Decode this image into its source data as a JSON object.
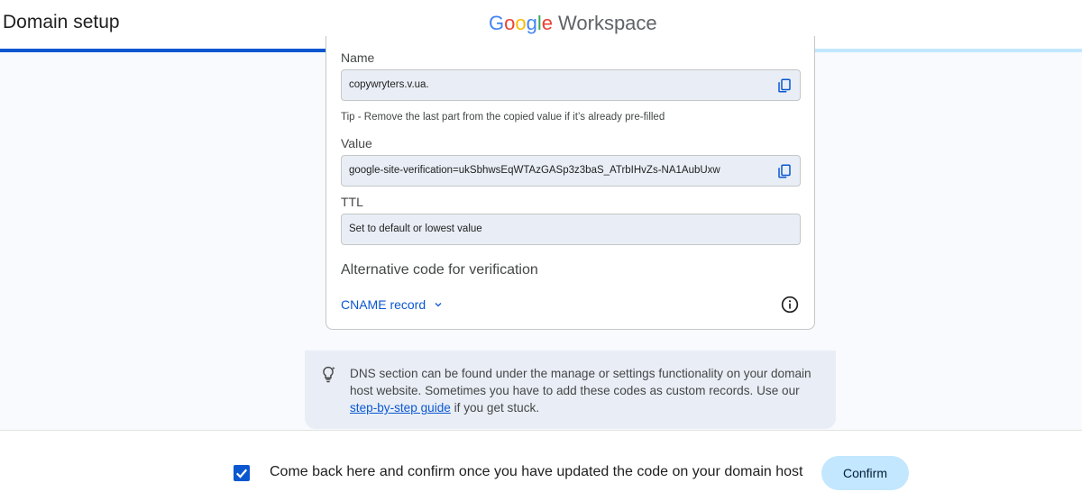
{
  "header": {
    "title": "Domain setup",
    "brand": {
      "google_letters": [
        "G",
        "o",
        "o",
        "g",
        "l",
        "e"
      ],
      "product": "Workspace"
    },
    "progress": 0.473
  },
  "record": {
    "name_label": "Name",
    "name_value": "copywryters.v.ua.",
    "tip": "Tip - Remove the last part from the copied value if it’s already pre-filled",
    "value_label": "Value",
    "value_value": "google-site-verification=ukSbhwsEqWTAzGASp3z3baS_ATrbIHvZs-NA1AubUxw",
    "ttl_label": "TTL",
    "ttl_value": "Set to default or lowest value",
    "alt_heading": "Alternative code for verification",
    "cname_label": "CNAME record"
  },
  "help": {
    "text_before": "DNS section can be found under the manage or settings functionality on your domain host website. Sometimes you have to add these codes as custom records. Use our ",
    "link": "step-by-step guide",
    "text_after": " if you get stuck."
  },
  "footer": {
    "confirm_text": "Come back here and confirm once you have updated the code on your domain host",
    "checkbox_checked": true,
    "confirm_button": "Confirm"
  },
  "colors": {
    "accent": "#0b57d0",
    "google_blue": "#4285f4",
    "google_red": "#ea4335",
    "google_yellow": "#fbbc04",
    "google_green": "#34a853"
  },
  "icons": [
    "copy-icon",
    "info-icon",
    "chevron-down-icon",
    "lightbulb-icon",
    "check-icon"
  ]
}
